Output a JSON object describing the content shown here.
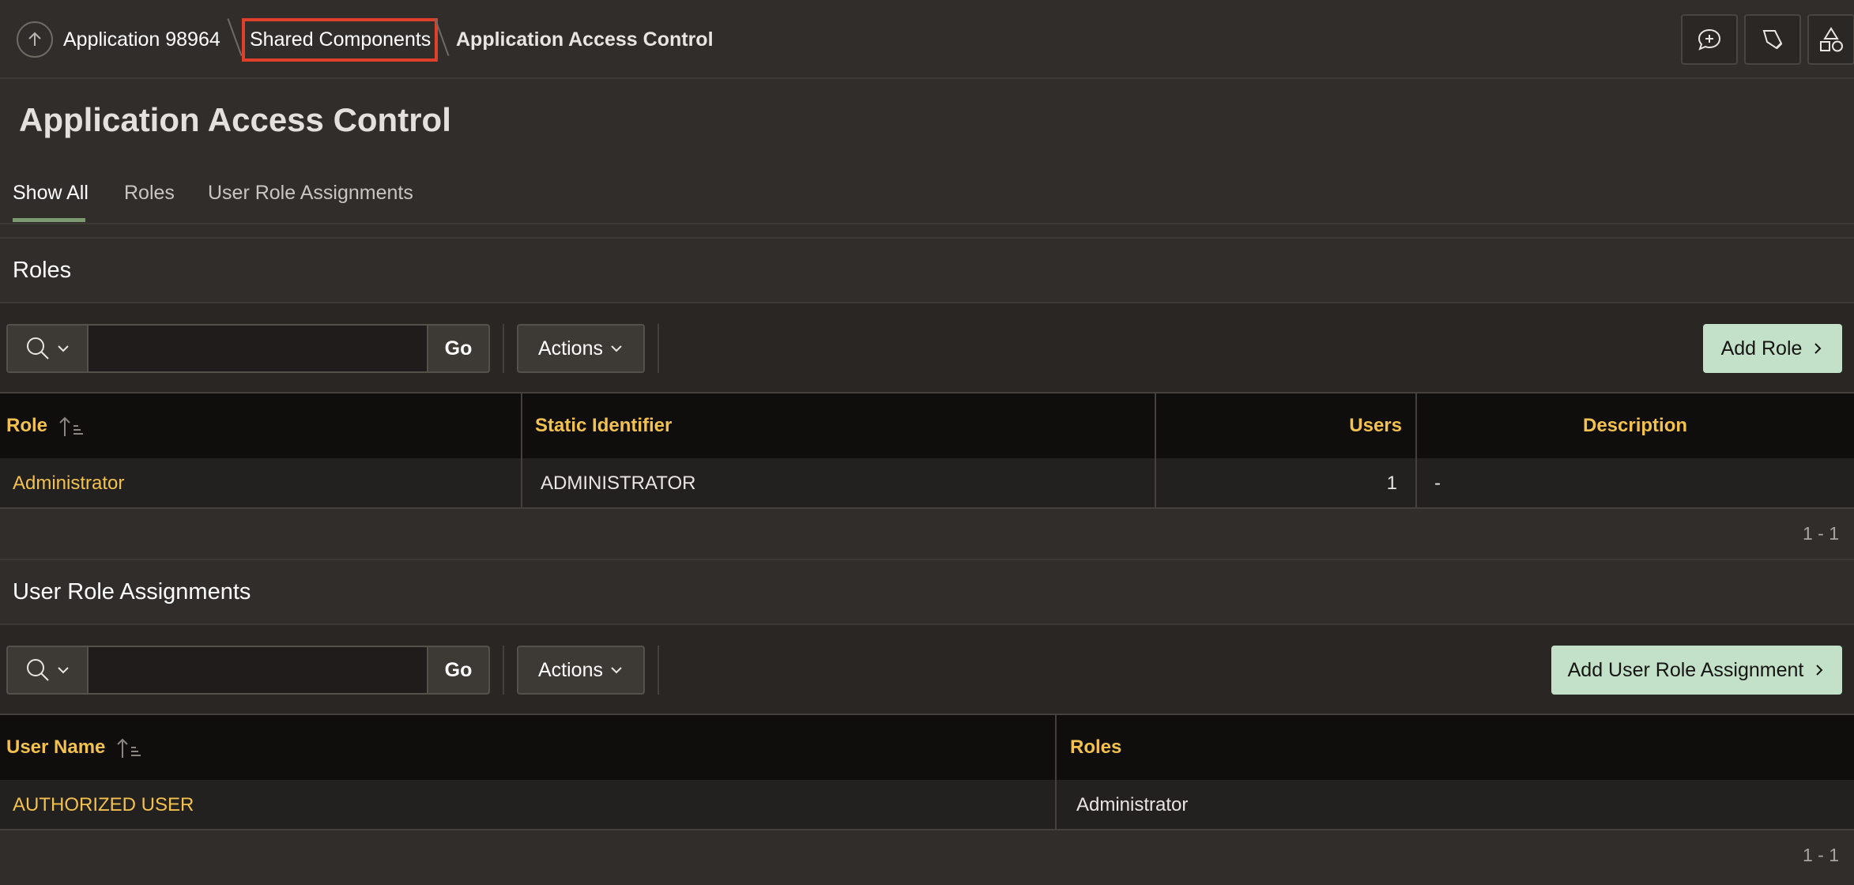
{
  "breadcrumb": {
    "items": [
      "Application 98964",
      "Shared Components",
      "Application Access Control"
    ]
  },
  "page_title": "Application Access Control",
  "tabs": [
    {
      "label": "Show All",
      "active": true
    },
    {
      "label": "Roles",
      "active": false
    },
    {
      "label": "User Role Assignments",
      "active": false
    }
  ],
  "roles_region": {
    "title": "Roles",
    "search": {
      "value": "",
      "go_label": "Go"
    },
    "actions_label": "Actions",
    "add_label": "Add Role",
    "columns": [
      "Role",
      "Static Identifier",
      "Users",
      "Description"
    ],
    "rows": [
      {
        "role": "Administrator",
        "static_id": "ADMINISTRATOR",
        "users": "1",
        "description": "-"
      }
    ],
    "pagination": "1 - 1"
  },
  "assignments_region": {
    "title": "User Role Assignments",
    "search": {
      "value": "",
      "go_label": "Go"
    },
    "actions_label": "Actions",
    "add_label": "Add User Role Assignment",
    "columns": [
      "User Name",
      "Roles"
    ],
    "rows": [
      {
        "user_name": "AUTHORIZED USER",
        "roles": "Administrator"
      }
    ],
    "pagination": "1 - 1"
  },
  "colors": {
    "background": "#312d2a",
    "link": "#f2c14e",
    "primary_button": "#c3e0c9",
    "highlight_box": "#e0402a",
    "tab_underline": "#7b9a6f"
  },
  "icons": [
    "arrow-up-icon",
    "chat-plus-icon",
    "brush-icon",
    "shapes-icon",
    "search-icon",
    "chevron-down-icon",
    "chevron-right-icon",
    "sort-ascending-icon"
  ]
}
